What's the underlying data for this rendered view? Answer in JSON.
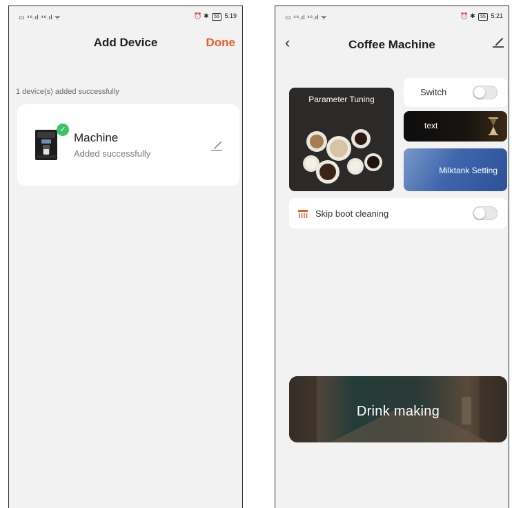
{
  "left_screen": {
    "status_bar": {
      "left": "▭ ⁴⁶.ıl ⁴⁶.ıl ᯤ",
      "right_icons": "⏰ ✱",
      "battery": "55",
      "time": "5:19"
    },
    "header": {
      "title": "Add Device",
      "done_label": "Done"
    },
    "success_summary": "1 device(s) added successfully",
    "device": {
      "name": "Machine",
      "status": "Added successfully",
      "check_glyph": "✓"
    }
  },
  "right_screen": {
    "status_bar": {
      "left": "▭ ⁴⁶.ıl ⁴⁶.ıl ᯤ",
      "right_icons": "⏰ ✱",
      "battery": "55",
      "time": "5:21"
    },
    "header": {
      "back_glyph": "‹",
      "title": "Coffee Machine"
    },
    "tiles": {
      "parameter_tuning": "Parameter Tuning",
      "switch": "Switch",
      "text": "text",
      "milktank_setting": "Milktank Setting",
      "skip_boot_cleaning": "Skip boot cleaning",
      "drink_making": "Drink making"
    },
    "toggles": {
      "switch_on": false,
      "skip_boot_cleaning_on": false
    }
  },
  "colors": {
    "accent": "#f05a2a",
    "success": "#3cc466",
    "screen_background": "#f2f2f2",
    "card_background": "#ffffff"
  },
  "icons": [
    "check-icon",
    "edit-pencil-icon",
    "back-chevron-icon",
    "skip-cleaning-icon",
    "hourglass-icon",
    "toggle-switch-icon",
    "coffee-machine-image"
  ]
}
